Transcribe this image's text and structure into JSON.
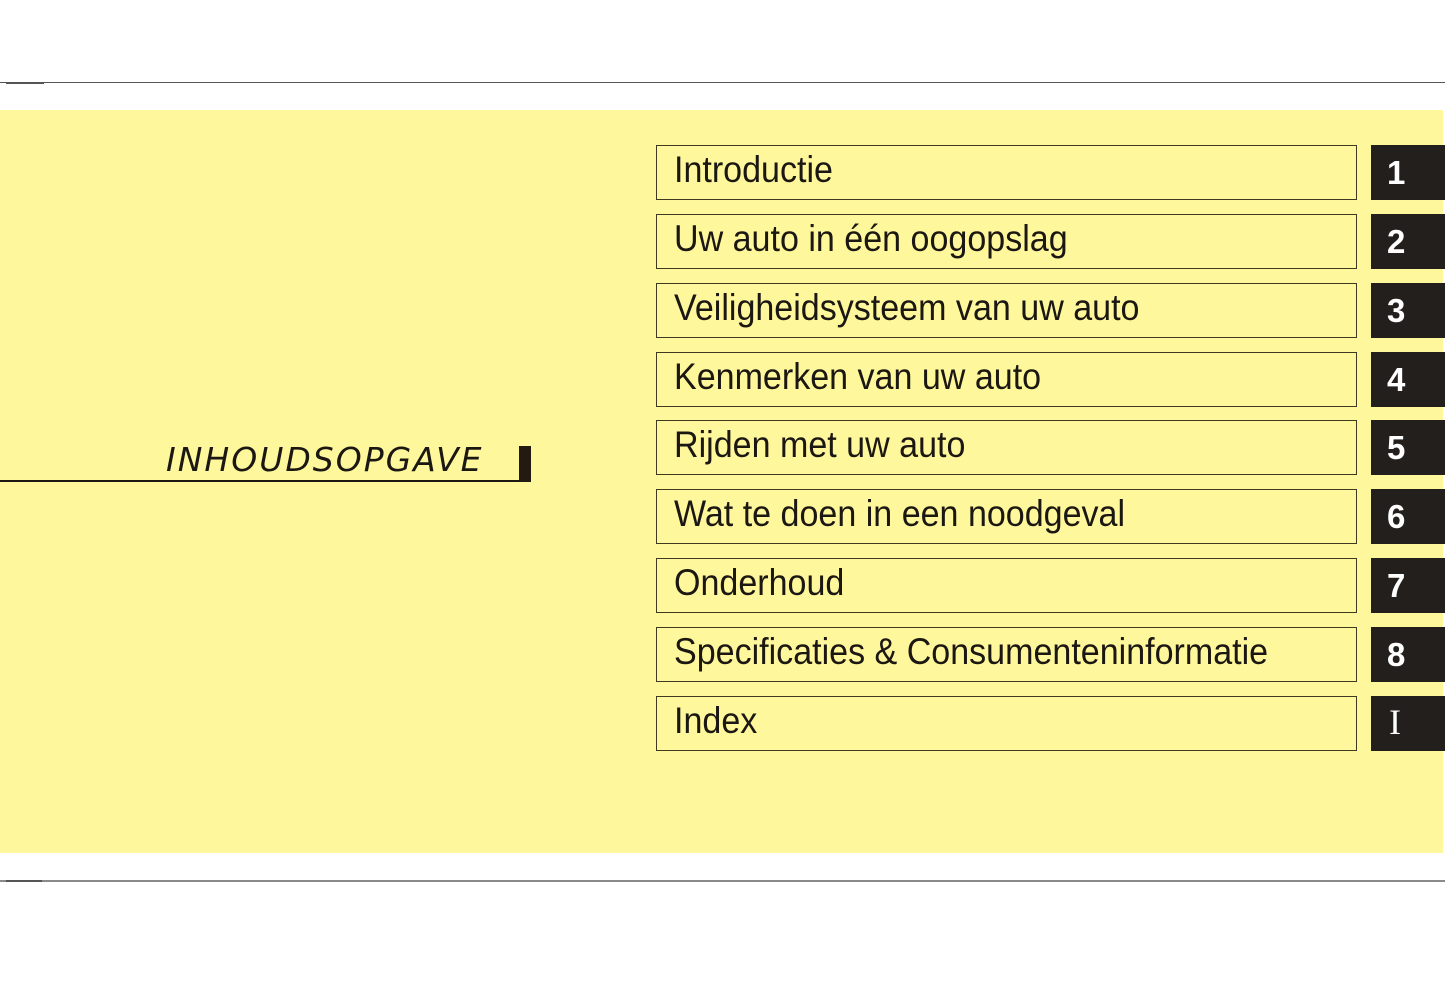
{
  "page": {
    "title": "INHOUDSOPGAVE",
    "colors": {
      "band": "#fff79b",
      "text": "#1b1712",
      "tab": "#231f1d",
      "tab_text": "#ffffff"
    }
  },
  "toc": {
    "items": [
      {
        "label": "Introductie",
        "number": "1"
      },
      {
        "label": "Uw auto in één oogopslag",
        "number": "2"
      },
      {
        "label": "Veiligheidsysteem van uw auto",
        "number": "3"
      },
      {
        "label": "Kenmerken van uw auto",
        "number": "4"
      },
      {
        "label": "Rijden met uw auto",
        "number": "5"
      },
      {
        "label": "Wat te doen in een noodgeval",
        "number": "6"
      },
      {
        "label": "Onderhoud",
        "number": "7"
      },
      {
        "label": "Specificaties & Consumenteninformatie",
        "number": "8"
      },
      {
        "label": "Index",
        "number": "I"
      }
    ]
  }
}
